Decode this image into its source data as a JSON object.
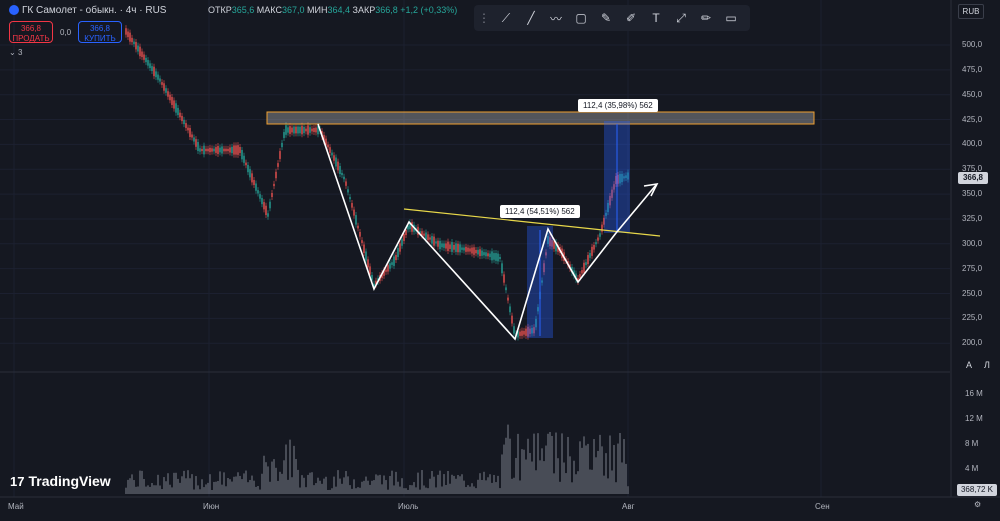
{
  "header": {
    "symbol_title": "ГК Самолет - обыкн. · 4ч · RUS",
    "ohlc_open_label": "ОТКР",
    "ohlc_open": "365,6",
    "ohlc_high_label": "МАКС",
    "ohlc_high": "367,0",
    "ohlc_low_label": "МИН",
    "ohlc_low": "364,4",
    "ohlc_close_label": "ЗАКР",
    "ohlc_close": "366,8",
    "change": "+1,2 (+0,33%)"
  },
  "trade": {
    "sell_price": "366,8",
    "sell_label": "ПРОДАТЬ",
    "spread": "0,0",
    "buy_price": "366,8",
    "buy_label": "КУПИТЬ",
    "indicators_count": "3"
  },
  "toolbar": {
    "tools": [
      "trend-line-icon",
      "ray-icon",
      "path-icon",
      "rectangle-icon",
      "brush-icon",
      "highlighter-icon",
      "text-icon",
      "measure-icon",
      "pencil-icon",
      "comment-icon"
    ]
  },
  "price_axis": {
    "currency": "RUB",
    "labels": [
      "500,0",
      "475,0",
      "450,0",
      "425,0",
      "400,0",
      "375,0",
      "350,0",
      "325,0",
      "300,0",
      "275,0",
      "250,0",
      "225,0",
      "200,0"
    ],
    "last_price": "366,8"
  },
  "volume_axis": {
    "labels": [
      "16 M",
      "12 M",
      "8 M",
      "4 M"
    ],
    "last_volume": "368,72 K"
  },
  "time_axis": {
    "labels": [
      "Май",
      "Июн",
      "Июль",
      "Авг",
      "Сен"
    ]
  },
  "measurements": {
    "first": "112,4 (54,51%) 562",
    "second": "112,4 (35,98%) 562"
  },
  "scale_buttons": {
    "auto": "A",
    "log": "Л"
  },
  "brand": {
    "name": "TradingView"
  },
  "colors": {
    "background": "#151821",
    "candle_up": "#26a69a",
    "candle_down": "#ef5350",
    "zone_border": "#f0a030",
    "trendline": "#e8d84a",
    "measure_fill": "#2962ff"
  }
}
